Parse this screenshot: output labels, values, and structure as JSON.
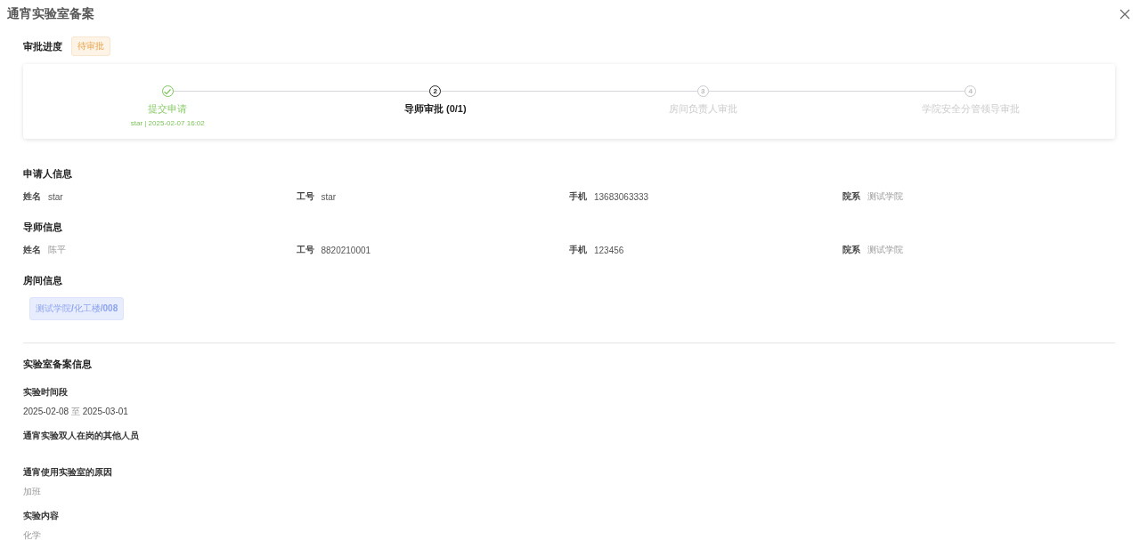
{
  "dialog": {
    "title": "通宵实验室备案"
  },
  "progress": {
    "heading": "审批进度",
    "status": "待审批",
    "steps": [
      {
        "label": "提交申请",
        "done": true,
        "current": false,
        "detail": "star | 2025-02-07 16:02"
      },
      {
        "number": "2",
        "label": "导师审批 (0/1)",
        "done": false,
        "current": true
      },
      {
        "number": "3",
        "label": "房间负责人审批",
        "done": false,
        "current": false
      },
      {
        "number": "4",
        "label": "学院安全分管领导审批",
        "done": false,
        "current": false
      }
    ]
  },
  "applicant": {
    "heading": "申请人信息",
    "fields": [
      {
        "label": "姓名",
        "value": "star",
        "muted": false
      },
      {
        "label": "工号",
        "value": "star",
        "muted": false
      },
      {
        "label": "手机",
        "value": "13683063333",
        "muted": false
      },
      {
        "label": "院系",
        "value": "测试学院",
        "muted": true
      }
    ]
  },
  "supervisor": {
    "heading": "导师信息",
    "fields": [
      {
        "label": "姓名",
        "value": "陈平",
        "muted": true
      },
      {
        "label": "工号",
        "value": "8820210001",
        "muted": false
      },
      {
        "label": "手机",
        "value": "123456",
        "muted": false
      },
      {
        "label": "院系",
        "value": "测试学院",
        "muted": true
      }
    ]
  },
  "room": {
    "heading": "房间信息",
    "tags": [
      "测试学院**/**化工楼**/008**"
    ]
  },
  "lab_record": {
    "heading": "实验室备案信息",
    "items": [
      {
        "kind": "range",
        "label": "实验时间段",
        "from": "2025-02-08",
        "separator": "至",
        "to": "2025-03-01"
      },
      {
        "kind": "text",
        "label": "通宵实验双人在岗的其他人员"
      },
      {
        "kind": "text",
        "label": "通宵使用实验室的原因",
        "value": "加班"
      },
      {
        "kind": "text",
        "label": "实验内容",
        "value": "化学"
      }
    ]
  }
}
